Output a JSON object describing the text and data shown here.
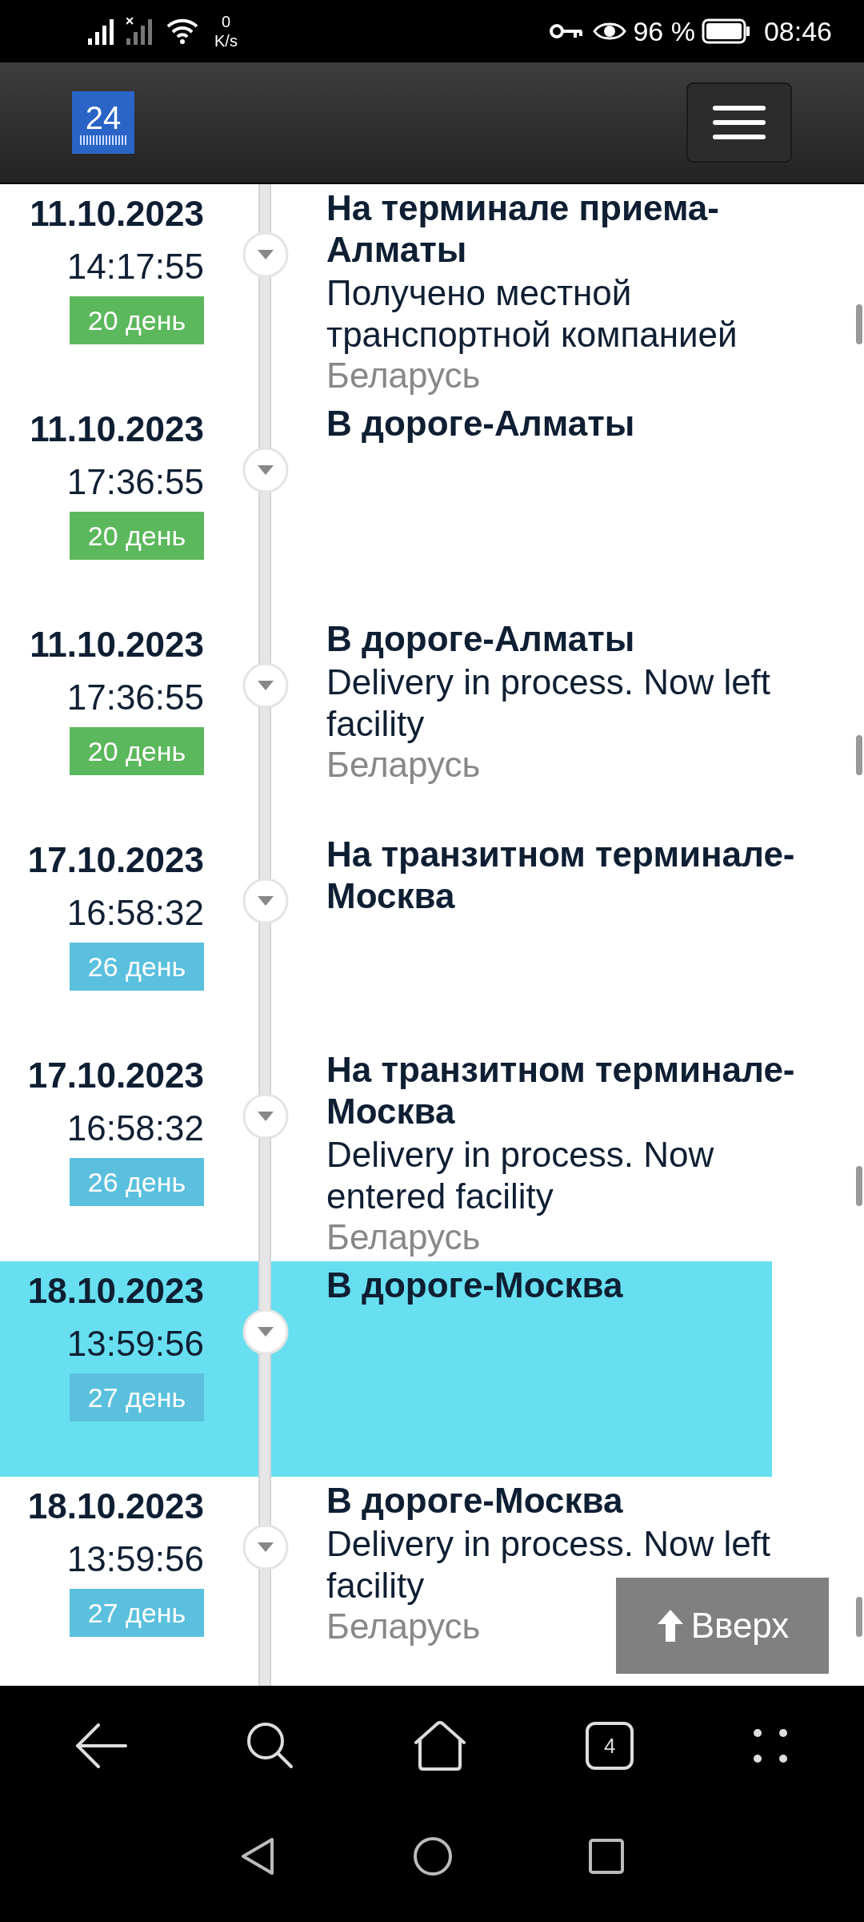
{
  "status_bar": {
    "speed_value": "0",
    "speed_unit": "K/s",
    "battery": "96 %",
    "time": "08:46"
  },
  "header": {
    "logo": "24"
  },
  "events": [
    {
      "date": "11.10.2023",
      "time": "14:17:55",
      "days": "20 день",
      "color": "#5cb85c",
      "title": "На терминале приема-Алматы",
      "description": "Получено местной транспортной компанией",
      "country": "Беларусь",
      "selected": false
    },
    {
      "date": "11.10.2023",
      "time": "17:36:55",
      "days": "20 день",
      "color": "#5cb85c",
      "title": "В дороге-Алматы",
      "selected": false
    },
    {
      "date": "11.10.2023",
      "time": "17:36:55",
      "days": "20 день",
      "color": "#5cb85c",
      "title": "В дороге-Алматы",
      "description": "Delivery in process. Now left facility",
      "country": "Беларусь",
      "selected": false
    },
    {
      "date": "17.10.2023",
      "time": "16:58:32",
      "days": "26 день",
      "color": "#5bc0de",
      "title": "На транзитном терминале-Москва",
      "selected": false
    },
    {
      "date": "17.10.2023",
      "time": "16:58:32",
      "days": "26 день",
      "color": "#5bc0de",
      "title": "На транзитном терминале-Москва",
      "description": "Delivery in process. Now entered facility",
      "country": "Беларусь",
      "selected": false
    },
    {
      "date": "18.10.2023",
      "time": "13:59:56",
      "days": "27 день",
      "color": "#5bc0de",
      "title": "В дороге-Москва",
      "selected": true
    },
    {
      "date": "18.10.2023",
      "time": "13:59:56",
      "days": "27 день",
      "color": "#5bc0de",
      "title": "В дороге-Москва",
      "description": "Delivery in process. Now left facility",
      "country": "Беларусь",
      "selected": false
    }
  ],
  "scroll_top_button": "Вверх",
  "browser_nav": {
    "tabs_count": "4"
  }
}
